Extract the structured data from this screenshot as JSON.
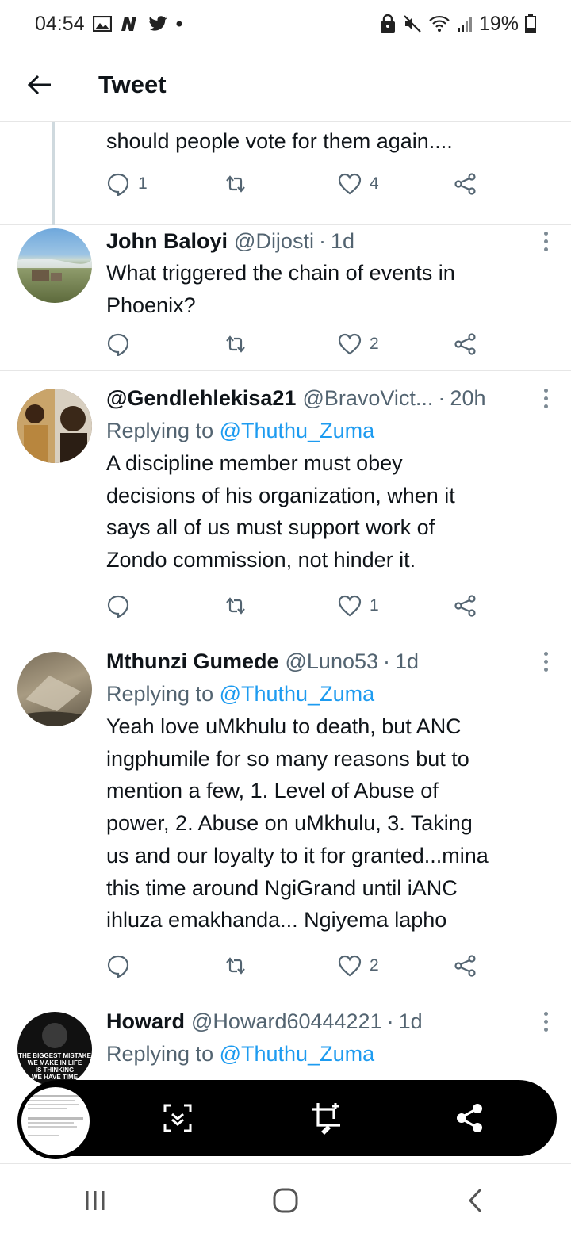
{
  "status_bar": {
    "time": "04:54",
    "battery": "19%"
  },
  "header": {
    "title": "Tweet"
  },
  "tweets": [
    {
      "text": "should people vote for them again....",
      "reply_count": "1",
      "retweet_count": "",
      "like_count": "4"
    },
    {
      "name": "John Baloyi",
      "handle": "@Dijosti",
      "separator": "·",
      "time": "1d",
      "text_lines": [
        "What triggered the chain of events in",
        "Phoenix?"
      ],
      "reply_count": "",
      "retweet_count": "",
      "like_count": "2"
    },
    {
      "name": "@Gendlehlekisa21",
      "handle": "@BravoVict...",
      "separator": "·",
      "time": "20h",
      "replying_prefix": "Replying to",
      "replying_to": "@Thuthu_Zuma",
      "text_lines": [
        "A discipline member must obey",
        "decisions of his organization, when it",
        "says all of us must support work of",
        "Zondo commission, not hinder it."
      ],
      "reply_count": "",
      "retweet_count": "",
      "like_count": "1"
    },
    {
      "name": "Mthunzi Gumede",
      "handle": "@Luno53",
      "separator": "·",
      "time": "1d",
      "replying_prefix": "Replying to",
      "replying_to": "@Thuthu_Zuma",
      "text_lines": [
        "Yeah love uMkhulu to death, but ANC",
        "ingphumile for so many reasons but to",
        "mention a few, 1. Level of Abuse of",
        "power, 2. Abuse on uMkhulu, 3. Taking",
        "us and our loyalty to it for granted...mina",
        "this time around NgiGrand until iANC",
        "ihluza emakhanda... Ngiyema lapho"
      ],
      "reply_count": "",
      "retweet_count": "",
      "like_count": "2"
    },
    {
      "name": "Howard",
      "handle": "@Howard60444221",
      "separator": "·",
      "time": "1d",
      "replying_prefix": "Replying to",
      "replying_to": "@Thuthu_Zuma",
      "avatar_text": [
        "THE BIGGEST MISTAKE",
        "WE MAKE IN LIFE",
        "IS THINKING",
        "WE HAVE TIME"
      ]
    }
  ],
  "icons": {
    "back": "arrow-left-icon",
    "reply": "speech-bubble-icon",
    "retweet": "retweet-icon",
    "like": "heart-icon",
    "share": "share-icon",
    "more": "vertical-ellipsis-icon",
    "scroll_capture": "scroll-capture-icon",
    "edit_screenshot": "crop-edit-icon",
    "share_screenshot": "share-nodes-icon",
    "nav_recents": "recents-icon",
    "nav_home": "home-icon",
    "nav_back": "back-chevron-icon"
  },
  "colors": {
    "link": "#1d9bf0",
    "muted": "#536471",
    "text": "#0f1419"
  }
}
